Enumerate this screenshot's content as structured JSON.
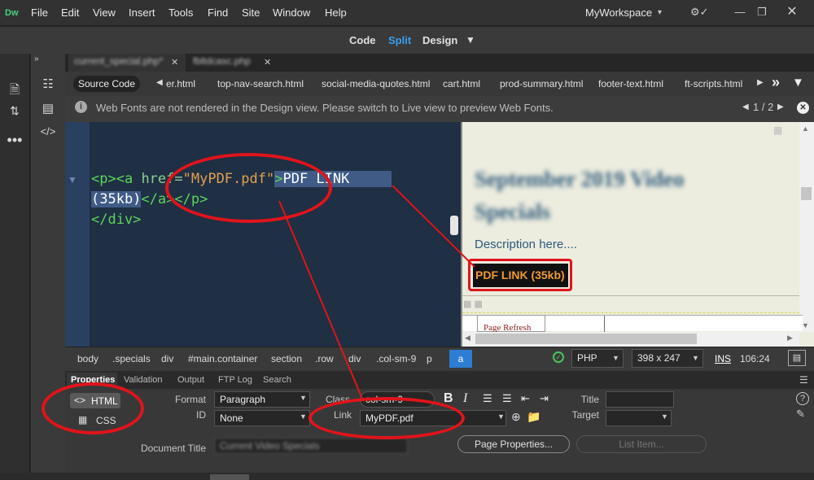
{
  "app": {
    "logo": "Dw"
  },
  "menu": [
    "File",
    "Edit",
    "View",
    "Insert",
    "Tools",
    "Find",
    "Site",
    "Window",
    "Help"
  ],
  "workspace": {
    "label": "MyWorkspace"
  },
  "views": {
    "code": "Code",
    "split": "Split",
    "design": "Design"
  },
  "tabs": [
    {
      "label": "current_special.php*"
    },
    {
      "label": "fbltdcasc.php"
    }
  ],
  "related": {
    "source_code": "Source Code",
    "files": [
      "er.html",
      "top-nav-search.html",
      "social-media-quotes.html",
      "cart.html",
      "prod-summary.html",
      "footer-text.html",
      "ft-scripts.html"
    ]
  },
  "info": {
    "message": "Web Fonts are not rendered in the Design view. Please switch to Live view to preview Web Fonts.",
    "pager": "1 / 2"
  },
  "code": {
    "l1_p": "<p>",
    "l1_a": "<a",
    "l1_attr": " href=",
    "l1_str": "\"MyPDF.pdf\"",
    "l1_close": ">",
    "l1_text": "PDF LINK",
    "l2_text": "(35kb)",
    "l2_tags": "</a></p>",
    "l3": "</div>"
  },
  "design": {
    "title": "September 2019 Video Specials",
    "description": "Description here....",
    "link": "PDF LINK (35kb)",
    "page_refresh": "Page Refresh"
  },
  "tag_selector": {
    "crumbs": [
      "body",
      ".specials",
      "div",
      "#main.container",
      "section",
      ".row",
      "div",
      ".col-sm-9",
      "p"
    ],
    "active": "a",
    "doc_type": "PHP",
    "size": "398 x 247",
    "mode": "INS",
    "position": "106:24"
  },
  "panel_tabs": [
    "Properties",
    "Validation",
    "Output",
    "FTP Log",
    "Search"
  ],
  "props": {
    "html": "HTML",
    "css": "CSS",
    "format_label": "Format",
    "format_value": "Paragraph",
    "id_label": "ID",
    "id_value": "None",
    "class_label": "Class",
    "class_value": "col-sm-9",
    "link_label": "Link",
    "link_value": "MyPDF.pdf",
    "title_label": "Title",
    "target_label": "Target",
    "doc_title_label": "Document Title",
    "doc_title_value": "Current Video Specials",
    "page_props": "Page Properties...",
    "list_item": "List Item..."
  },
  "colors": {
    "accent": "#2d7dd2",
    "annotation": "#e0141b",
    "code_bg": "#1f2f44",
    "link_highlight": "#ef9a2e"
  }
}
